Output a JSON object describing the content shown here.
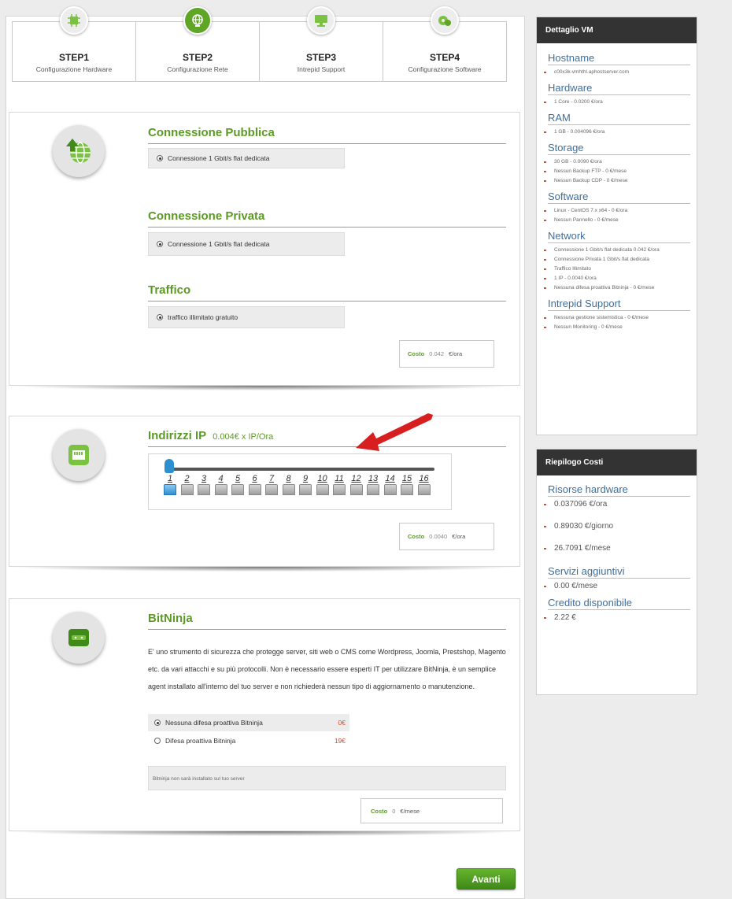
{
  "steps": [
    {
      "title": "STEP1",
      "subtitle": "Configurazione Hardware",
      "icon": "hardware-icon",
      "active": false
    },
    {
      "title": "STEP2",
      "subtitle": "Configurazione Rete",
      "icon": "network-globe-icon",
      "active": true
    },
    {
      "title": "STEP3",
      "subtitle": "Intrepid Support",
      "icon": "monitor-support-icon",
      "active": false
    },
    {
      "title": "STEP4",
      "subtitle": "Configurazione Software",
      "icon": "software-gear-icon",
      "active": false
    }
  ],
  "network": {
    "public": {
      "title": "Connessione Pubblica",
      "option": "Connessione 1 Gbit/s flat dedicata"
    },
    "private": {
      "title": "Connessione Privata",
      "option": "Connessione 1 Gbit/s flat dedicata"
    },
    "traffic": {
      "title": "Traffico",
      "option": "traffico illimitato gratuito"
    },
    "cost": {
      "label": "Costo",
      "value": "0.042",
      "unit": "€/ora"
    }
  },
  "ip": {
    "title": "Indirizzi IP",
    "subtitle": "0.004€ x IP/Ora",
    "numbers": [
      "1",
      "2",
      "3",
      "4",
      "5",
      "6",
      "7",
      "8",
      "9",
      "10",
      "11",
      "12",
      "13",
      "14",
      "15",
      "16"
    ],
    "selected": 1,
    "cost": {
      "label": "Costo",
      "value": "0.0040",
      "unit": "€/ora"
    }
  },
  "bitninja": {
    "title": "BitNinja",
    "description": "E' uno strumento di sicurezza che protegge server, siti web o CMS come Wordpress, Joomla, Prestshop, Magento etc. da vari attacchi e su più protocolli. Non è necessario essere esperti IT per utilizzare BitNinja, è un semplice agent installato all'interno del tuo server e non richiederà nessun tipo di aggiornamento o manutenzione.",
    "options": [
      {
        "label": "Nessuna difesa proattiva Bitninja",
        "price": "0€",
        "selected": true
      },
      {
        "label": "Difesa proattiva Bitninja",
        "price": "19€",
        "selected": false
      }
    ],
    "notice": "Bitninja non sarà installato sul tuo server",
    "cost": {
      "label": "Costo",
      "value": "0",
      "unit": "€/mese"
    }
  },
  "next_button": "Avanti",
  "vm_detail": {
    "title": "Dettaglio VM",
    "sections": [
      {
        "name": "Hostname",
        "items": [
          "c00x3k-vmhthl.aphostserver.com"
        ]
      },
      {
        "name": "Hardware",
        "items": [
          "1 Core - 0.0200 €/ora"
        ]
      },
      {
        "name": "RAM",
        "items": [
          "1 GB - 0.004096 €/ora"
        ]
      },
      {
        "name": "Storage",
        "items": [
          "30 GB - 0.0090 €/ora",
          "Nessun Backup FTP - 0 €/mese",
          "Nessun Backup CDP - 0 €/mese"
        ]
      },
      {
        "name": "Software",
        "items": [
          "Linux - CentOS 7.x x64 - 0 €/ora",
          "Nessun Pannello - 0 €/mese"
        ]
      },
      {
        "name": "Network",
        "items": [
          "Connessione 1 Gbit/s flat dedicata 0.042 €/ora",
          "Connessione Privata 1 Gbit/s flat dedicata",
          "Traffico Illimitato",
          "1 IP - 0.0040 €/ora",
          "Nessuna difesa proattiva Bitninja - 0 €/mese"
        ]
      },
      {
        "name": "Intrepid Support",
        "items": [
          "Nessuna gestione sistemistica - 0 €/mese",
          "Nessun Monitoring - 0 €/mese"
        ]
      }
    ]
  },
  "cost_summary": {
    "title": "Riepilogo Costi",
    "sections": [
      {
        "name": "Risorse hardware",
        "items": [
          "0.037096 €/ora",
          "0.89030 €/giorno",
          "26.7091 €/mese"
        ]
      },
      {
        "name": "Servizi aggiuntivi",
        "items": [
          "0.00 €/mese"
        ]
      },
      {
        "name": "Credito disponibile",
        "items": [
          "2.22 €"
        ]
      }
    ]
  },
  "colors": {
    "accent_green": "#5c9a25",
    "header_dark": "#333333",
    "bullet_red": "#d44b2c",
    "slider_blue": "#2d8fd0"
  }
}
